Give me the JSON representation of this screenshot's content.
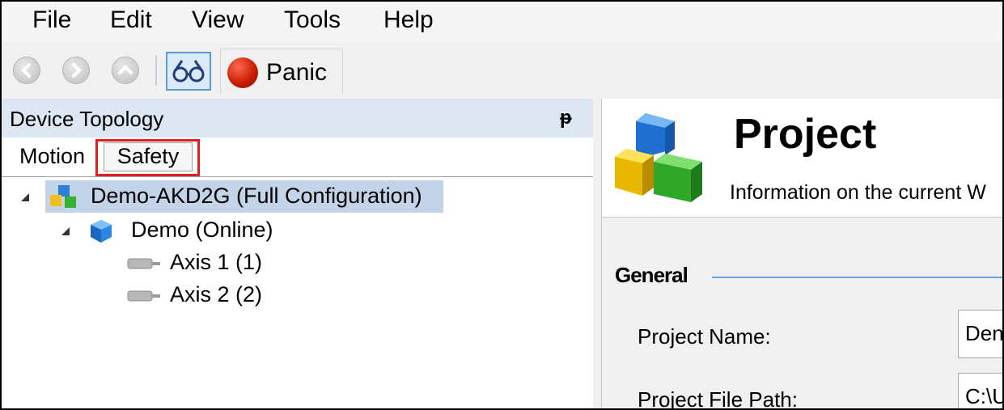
{
  "menu": [
    "File",
    "Edit",
    "View",
    "Tools",
    "Help"
  ],
  "toolbar": {
    "back_icon": "back-arrow-icon",
    "forward_icon": "forward-arrow-icon",
    "up_icon": "up-arrow-icon",
    "glasses_icon": "glasses-icon",
    "panic_label": "Panic"
  },
  "left_panel": {
    "title": "Device Topology",
    "pin_glyph": "ᵽ",
    "tabs": [
      "Motion",
      "Safety"
    ],
    "tree": {
      "root": "Demo-AKD2G (Full Configuration)",
      "device": "Demo (Online)",
      "axes": [
        "Axis 1 (1)",
        "Axis 2 (2)"
      ]
    }
  },
  "right_panel": {
    "title": "Project",
    "subtitle": "Information on the current W",
    "section": "General",
    "fields": [
      {
        "label": "Project Name:",
        "value": "Den"
      },
      {
        "label": "Project File Path:",
        "value": "C:\\U"
      }
    ]
  },
  "colors": {
    "highlight_border": "#e02020",
    "selection": "#c3d3e8",
    "panel_header": "#dde6f3",
    "accent_line": "#6aa7e0"
  }
}
